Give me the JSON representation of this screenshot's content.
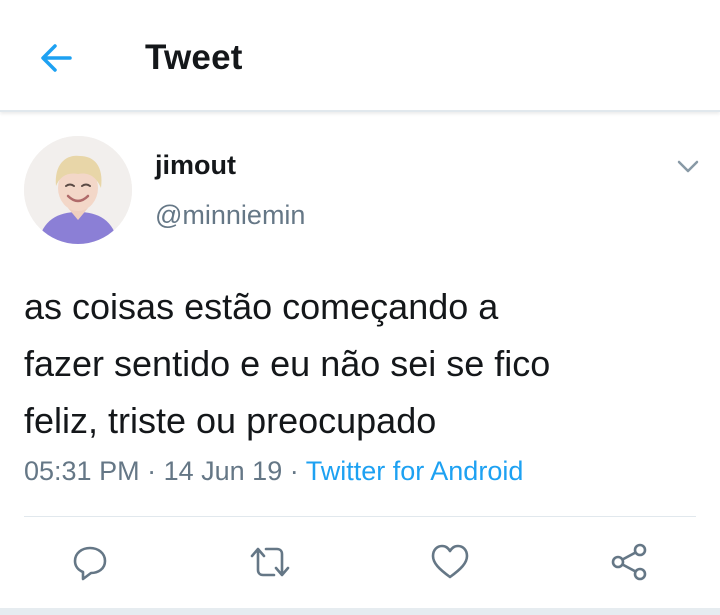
{
  "header": {
    "title": "Tweet",
    "back_icon": "arrow-left-icon"
  },
  "tweet": {
    "author": {
      "name": "jimout",
      "handle": "@minniemin",
      "avatar_icon": "profile-photo"
    },
    "text_lines": [
      "as coisas estão começando a",
      "fazer sentido e eu não sei se fico",
      "feliz, triste ou preocupado"
    ],
    "time": "05:31 PM",
    "separator": "·",
    "date": "14 Jun 19",
    "source": "Twitter for Android"
  },
  "actions": [
    "reply-icon",
    "retweet-icon",
    "like-icon",
    "share-icon"
  ],
  "colors": {
    "accent": "#1da1f2",
    "text_primary": "#14171a",
    "text_secondary": "#657786",
    "divider": "#e1e8ed"
  }
}
